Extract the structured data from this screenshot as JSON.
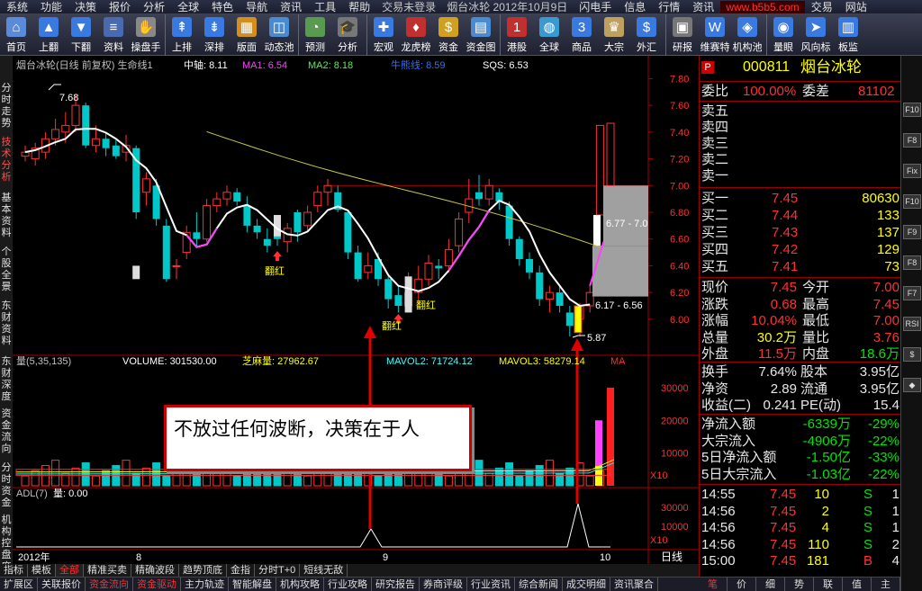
{
  "menu": {
    "items": [
      "系统",
      "功能",
      "决策",
      "报价",
      "分析",
      "全球",
      "特色",
      "导航",
      "资讯",
      "工具",
      "帮助"
    ],
    "status": "交易未登录",
    "title": "烟台冰轮  2012年10月9日",
    "right_items": [
      "闪电手",
      "信息",
      "行情",
      "资讯",
      "交易",
      "网站"
    ],
    "marquee": "www.b5b5.com"
  },
  "toolbar": [
    {
      "label": "首页",
      "icon": "home-icon",
      "color": "#5a8ad8",
      "glyph": "⌂"
    },
    {
      "label": "上翻",
      "icon": "arrow-up-icon",
      "color": "#3a7ae0",
      "glyph": "▲"
    },
    {
      "label": "下翻",
      "icon": "arrow-down-icon",
      "color": "#3a7ae0",
      "glyph": "▼"
    },
    {
      "label": "资料",
      "icon": "document-icon",
      "color": "#4a6ab0",
      "glyph": "≡"
    },
    {
      "label": "操盘手",
      "icon": "trader-icon",
      "color": "#888",
      "glyph": "✋"
    },
    {
      "sep": true
    },
    {
      "label": "上排",
      "icon": "row-up-icon",
      "color": "#3a7ae0",
      "glyph": "⇞"
    },
    {
      "label": "深排",
      "icon": "row-down-icon",
      "color": "#3a7ae0",
      "glyph": "⇟"
    },
    {
      "label": "版面",
      "icon": "layout-icon",
      "color": "#d09020",
      "glyph": "▦"
    },
    {
      "label": "动态池",
      "icon": "pool-icon",
      "color": "#4a8ad0",
      "glyph": "◫"
    },
    {
      "sep": true
    },
    {
      "label": "预测",
      "icon": "forecast-icon",
      "color": "#5a9a50",
      "glyph": "◔"
    },
    {
      "label": "分析",
      "icon": "analysis-icon",
      "color": "#777",
      "glyph": "🎓"
    },
    {
      "sep": true
    },
    {
      "label": "宏观",
      "icon": "macro-icon",
      "color": "#3a7ae0",
      "glyph": "✚"
    },
    {
      "label": "龙虎榜",
      "icon": "dragon-icon",
      "color": "#c03030",
      "glyph": "♦"
    },
    {
      "label": "资金",
      "icon": "money-icon",
      "color": "#d0a020",
      "glyph": "$"
    },
    {
      "label": "资金图",
      "icon": "money-chart-icon",
      "color": "#4a8ad0",
      "glyph": "▤"
    },
    {
      "sep": true
    },
    {
      "label": "港股",
      "icon": "hk-icon",
      "color": "#c03030",
      "glyph": "1"
    },
    {
      "label": "全球",
      "icon": "globe-icon",
      "color": "#3a9ad0",
      "glyph": "◍"
    },
    {
      "label": "商品",
      "icon": "commodity-icon",
      "color": "#3a7ae0",
      "glyph": "3"
    },
    {
      "label": "大宗",
      "icon": "bulk-icon",
      "color": "#c0a060",
      "glyph": "♛"
    },
    {
      "label": "外汇",
      "icon": "forex-icon",
      "color": "#3a7ae0",
      "glyph": "$"
    },
    {
      "sep": true
    },
    {
      "label": "研报",
      "icon": "report-icon",
      "color": "#777",
      "glyph": "▣"
    },
    {
      "label": "维赛特",
      "icon": "wst-icon",
      "color": "#3a7ae0",
      "glyph": "W"
    },
    {
      "label": "机构池",
      "icon": "institution-icon",
      "color": "#3a7ae0",
      "glyph": "◈"
    },
    {
      "sep": true
    },
    {
      "label": "量眼",
      "icon": "eye-icon",
      "color": "#3a7ae0",
      "glyph": "◉"
    },
    {
      "label": "风向标",
      "icon": "vane-icon",
      "color": "#3a7ae0",
      "glyph": "➤"
    },
    {
      "label": "板监",
      "icon": "monitor-icon",
      "color": "#3a7ae0",
      "glyph": "▥"
    }
  ],
  "left_tabs": [
    "分时走势",
    "技术分析",
    "基本资料",
    "个股全景",
    "东财资料",
    "东财深度",
    "资金流向",
    "分时资金",
    "机构控盘度"
  ],
  "chart": {
    "main_header": {
      "name": "烟台冰轮(日线 前复权) 生命线1",
      "zhongzhou": "中轴: 8.11",
      "ma1": "MA1: 6.54",
      "ma2": "MA2: 8.18",
      "sqs_hidden": "牛熊线: 8.59",
      "sqs": "SQS: 6.53"
    },
    "vol_header": {
      "name": "量(5,35,135)",
      "volume": "VOLUME: 301530.00",
      "zhima": "芝麻量: 27962.67",
      "mavol2": "MAVOL2: 71724.12",
      "mavol3": "MAVOL3: 58279.14",
      "ma": "MA"
    },
    "adl_header": {
      "name": "ADL(7)",
      "value": "量: 0.00"
    },
    "annotations": {
      "high": "7.68",
      "low": "5.87",
      "box1": "6.77 - 7.0",
      "box2": "6.17 - 6.56",
      "fanhong1": "翻红",
      "fanhong2": "翻红",
      "fanhong3": "翻红",
      "x10a": "X10",
      "x10b": "X10"
    },
    "x_axis": [
      "2012年",
      "8",
      "9",
      "10"
    ],
    "x_unit": "日线"
  },
  "chart_data": {
    "type": "candlestick",
    "y_ticks": [
      7.8,
      7.6,
      7.4,
      7.2,
      7.0,
      6.8,
      6.6,
      6.4,
      6.2,
      6.0
    ],
    "vol_ticks": [
      30000,
      20000,
      10000
    ],
    "adl_ticks": [
      30000,
      10000
    ],
    "ylim": [
      5.75,
      7.85
    ],
    "candles": [
      [
        7.22,
        7.25,
        7.18,
        7.3
      ],
      [
        7.2,
        7.28,
        7.15,
        7.32
      ],
      [
        7.25,
        7.35,
        7.2,
        7.4
      ],
      [
        7.35,
        7.42,
        7.3,
        7.5
      ],
      [
        7.4,
        7.45,
        7.32,
        7.55
      ],
      [
        7.45,
        7.6,
        7.4,
        7.68
      ],
      [
        7.6,
        7.3,
        7.28,
        7.62
      ],
      [
        7.3,
        7.35,
        7.25,
        7.45
      ],
      [
        7.35,
        7.28,
        7.22,
        7.4
      ],
      [
        7.3,
        7.22,
        7.2,
        7.34
      ],
      [
        7.25,
        7.3,
        7.18,
        7.38
      ],
      [
        7.28,
        6.8,
        6.75,
        7.3
      ],
      [
        6.95,
        7.05,
        6.85,
        7.1
      ],
      [
        7.0,
        6.75,
        6.7,
        7.05
      ],
      [
        6.7,
        6.3,
        6.28,
        6.75
      ],
      [
        6.4,
        6.4,
        6.3,
        6.45
      ],
      [
        6.5,
        6.65,
        6.45,
        6.7
      ],
      [
        6.65,
        6.6,
        6.55,
        6.8
      ],
      [
        6.6,
        6.85,
        6.58,
        6.9
      ],
      [
        6.85,
        6.9,
        6.8,
        6.95
      ],
      [
        6.9,
        6.95,
        6.85,
        7.0
      ],
      [
        6.95,
        6.88,
        6.85,
        6.98
      ],
      [
        6.85,
        6.7,
        6.65,
        6.92
      ],
      [
        6.7,
        6.65,
        6.6,
        6.75
      ],
      [
        6.6,
        6.55,
        6.5,
        6.68
      ],
      [
        6.65,
        6.6,
        6.55,
        6.75
      ],
      [
        6.58,
        6.68,
        6.5,
        6.72
      ],
      [
        6.8,
        6.65,
        6.58,
        6.82
      ],
      [
        6.7,
        6.8,
        6.65,
        6.85
      ],
      [
        6.85,
        6.95,
        6.8,
        7.0
      ],
      [
        6.95,
        7.0,
        6.85,
        7.05
      ],
      [
        6.95,
        6.82,
        6.8,
        7.0
      ],
      [
        6.8,
        6.5,
        6.45,
        6.82
      ],
      [
        6.5,
        6.3,
        6.28,
        6.55
      ],
      [
        6.35,
        6.4,
        6.3,
        6.5
      ],
      [
        6.45,
        6.3,
        6.25,
        6.5
      ],
      [
        6.3,
        6.15,
        6.08,
        6.32
      ],
      [
        6.18,
        6.1,
        6.05,
        6.25
      ],
      [
        6.1,
        6.2,
        6.05,
        6.35
      ],
      [
        6.2,
        6.3,
        6.12,
        6.4
      ],
      [
        6.3,
        6.42,
        6.25,
        6.48
      ],
      [
        6.4,
        6.38,
        6.3,
        6.45
      ],
      [
        6.4,
        6.52,
        6.35,
        6.6
      ],
      [
        6.55,
        6.75,
        6.5,
        6.8
      ],
      [
        6.8,
        6.9,
        6.72,
        7.05
      ],
      [
        6.95,
        6.9,
        6.85,
        7.08
      ],
      [
        6.9,
        7.0,
        6.85,
        7.05
      ],
      [
        6.95,
        6.88,
        6.82,
        6.98
      ],
      [
        6.85,
        6.6,
        6.55,
        6.88
      ],
      [
        6.6,
        6.45,
        6.4,
        6.62
      ],
      [
        6.45,
        6.35,
        6.3,
        6.5
      ],
      [
        6.35,
        6.15,
        6.1,
        6.4
      ],
      [
        6.15,
        6.2,
        6.05,
        6.25
      ],
      [
        6.2,
        6.1,
        6.05,
        6.25
      ],
      [
        6.05,
        5.95,
        5.87,
        6.1
      ],
      [
        6.0,
        6.1,
        5.87,
        6.12
      ],
      [
        6.1,
        6.2,
        6.05,
        6.25
      ],
      [
        6.78,
        7.45,
        6.78,
        7.45
      ]
    ]
  },
  "quote": {
    "code": "000811",
    "name": "烟台冰轮",
    "weibi_label": "委比",
    "weibi": "100.00%",
    "weicha_label": "委差",
    "weicha": "81102",
    "sell": [
      "卖五",
      "卖四",
      "卖三",
      "卖二",
      "卖一"
    ],
    "buy": [
      {
        "label": "买一",
        "price": "7.45",
        "vol": "80630"
      },
      {
        "label": "买二",
        "price": "7.44",
        "vol": "133"
      },
      {
        "label": "买三",
        "price": "7.43",
        "vol": "137"
      },
      {
        "label": "买四",
        "price": "7.42",
        "vol": "129"
      },
      {
        "label": "买五",
        "price": "7.41",
        "vol": "73"
      }
    ],
    "stats": [
      {
        "l1": "现价",
        "v1": "7.45",
        "c1": "red",
        "l2": "今开",
        "v2": "7.00",
        "c2": "red"
      },
      {
        "l1": "涨跌",
        "v1": "0.68",
        "c1": "red",
        "l2": "最高",
        "v2": "7.45",
        "c2": "red"
      },
      {
        "l1": "涨幅",
        "v1": "10.04%",
        "c1": "red",
        "l2": "最低",
        "v2": "7.00",
        "c2": "red"
      },
      {
        "l1": "总量",
        "v1": "30.2万",
        "c1": "yel",
        "l2": "量比",
        "v2": "3.76",
        "c2": "red"
      },
      {
        "l1": "外盘",
        "v1": "11.5万",
        "c1": "red",
        "l2": "内盘",
        "v2": "18.6万",
        "c2": "grn"
      }
    ],
    "fund": [
      {
        "l1": "换手",
        "v1": "7.64%",
        "l2": "股本",
        "v2": "3.95亿"
      },
      {
        "l1": "净资",
        "v1": "2.89",
        "l2": "流通",
        "v2": "3.95亿"
      },
      {
        "l1": "收益(二)",
        "v1": "0.241",
        "l2": "PE(动)",
        "v2": "15.4"
      }
    ],
    "flows": [
      {
        "l": "净流入额",
        "v": "-6339万",
        "p": "-29%"
      },
      {
        "l": "大宗流入",
        "v": "-4906万",
        "p": "-22%"
      },
      {
        "l": "5日净流入额",
        "v": "-1.50亿",
        "p": "-33%"
      },
      {
        "l": "5日大宗流入",
        "v": "-1.03亿",
        "p": "-22%"
      }
    ],
    "ticks": [
      {
        "t": "14:55",
        "p": "7.45",
        "v": "10",
        "s": "S",
        "n": "1"
      },
      {
        "t": "14:56",
        "p": "7.45",
        "v": "2",
        "s": "S",
        "n": "1"
      },
      {
        "t": "14:56",
        "p": "7.45",
        "v": "4",
        "s": "S",
        "n": "1"
      },
      {
        "t": "14:56",
        "p": "7.45",
        "v": "110",
        "s": "S",
        "n": "2"
      },
      {
        "t": "15:00",
        "p": "7.45",
        "v": "181",
        "s": "B",
        "n": "4"
      }
    ],
    "p_badge": "P"
  },
  "bottom_tabs": [
    "指标",
    "模板",
    "全部",
    "精准买卖",
    "精确波段",
    "趋势顶底",
    "金指",
    "分时T+0",
    "短线无敌"
  ],
  "bottom_tabs2": [
    "扩展区",
    "关联报价",
    "资金流向",
    "资金驱动",
    "主力轨迹",
    "智能解盘",
    "机构攻略",
    "行业攻略",
    "研究报告",
    "券商评级",
    "行业资讯",
    "综合新闻",
    "成交明细",
    "资讯聚合"
  ],
  "right_tabs": [
    "笔",
    "价",
    "细",
    "势",
    "联",
    "值",
    "主"
  ],
  "right_strip": [
    "F10",
    "F8",
    "Fix",
    "F10",
    "F9",
    "F8",
    "F7",
    "RSI",
    "$",
    "◆"
  ],
  "callout": "不放过任何波断，决策在于人"
}
